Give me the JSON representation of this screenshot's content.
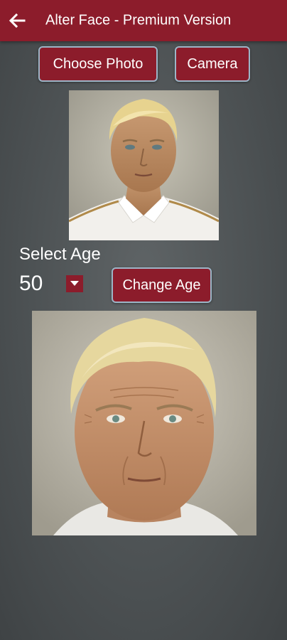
{
  "app": {
    "title": "Alter Face - Premium Version",
    "primary_color": "#8c1c2b"
  },
  "header": {
    "back_icon": "arrow-left-icon"
  },
  "buttons": {
    "choose_photo": "Choose Photo",
    "camera": "Camera",
    "change_age": "Change Age"
  },
  "age": {
    "label": "Select Age",
    "value": "50",
    "dropdown_icon": "caret-down-icon"
  },
  "images": {
    "original": "portrait of young blond man in white shirt",
    "aged": "aged portrait of the same blond man"
  }
}
